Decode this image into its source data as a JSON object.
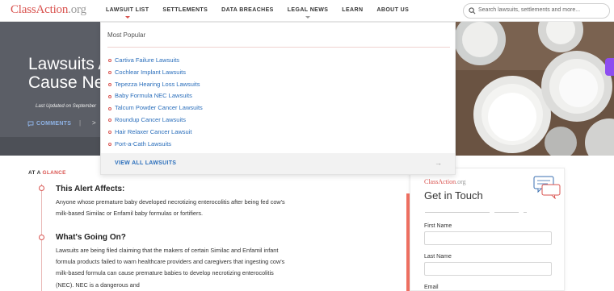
{
  "header": {
    "logo_name": "ClassAction",
    "logo_tld": ".org",
    "nav": [
      {
        "label": "LAWSUIT LIST"
      },
      {
        "label": "SETTLEMENTS"
      },
      {
        "label": "DATA BREACHES"
      },
      {
        "label": "LEGAL NEWS"
      },
      {
        "label": "LEARN"
      },
      {
        "label": "ABOUT US"
      }
    ],
    "search_placeholder": "Search lawsuits, settlements and more..."
  },
  "hero": {
    "title": "Lawsuits A\nCause Nec",
    "last_updated": "Last Updated on September",
    "comments_label": "COMMENTS",
    "separator": "|",
    "next_symbol": ">"
  },
  "dropdown": {
    "heading": "Most Popular",
    "items": [
      "Cartiva Failure Lawsuits",
      "Cochlear Implant Lawsuits",
      "Tepezza Hearing Loss Lawsuits",
      "Baby Formula NEC Lawsuits",
      "Talcum Powder Cancer Lawsuits",
      "Roundup Cancer Lawsuits",
      "Hair Relaxer Cancer Lawsuit",
      "Port-a-Cath Lawsuits"
    ],
    "view_all": "VIEW ALL LAWSUITS",
    "arrow": "→"
  },
  "article": {
    "glance_prefix": "AT A ",
    "glance_highlight": "GLANCE",
    "section1_title": "This Alert Affects:",
    "section1_text": "Anyone whose premature baby developed necrotizing enterocolitis after being fed cow's milk-based Similac or Enfamil baby formulas or fortifiers.",
    "section2_title": "What's Going On?",
    "section2_text": "Lawsuits are being filed claiming that the makers of certain Similac and Enfamil infant formula products failed to warn healthcare providers and caregivers that ingesting cow's milk-based formula can cause premature babies to develop necrotizing enterocolitis (NEC). NEC is a dangerous and"
  },
  "form": {
    "logo_name": "ClassAction",
    "logo_tld": ".org",
    "title": "Get in Touch",
    "first_name_label": "First Name",
    "last_name_label": "Last Name",
    "email_label": "Email"
  },
  "colors": {
    "brand_red": "#d9534f",
    "link_blue": "#2a6ebb",
    "hero_grey": "#5b5e66",
    "accent_purple": "#8e4df0"
  }
}
